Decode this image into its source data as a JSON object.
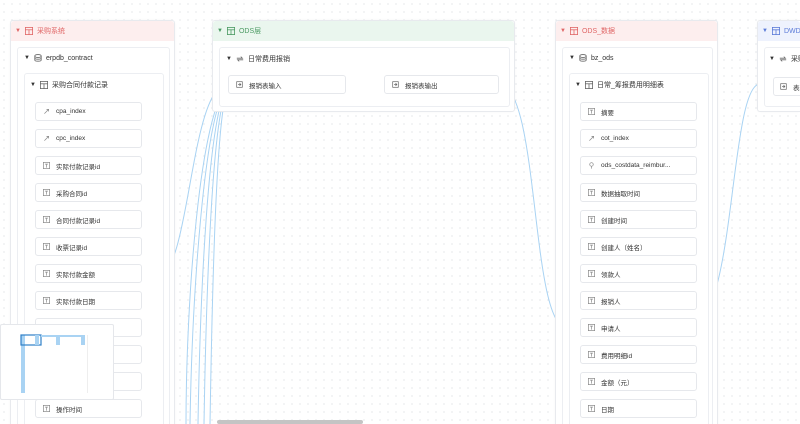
{
  "colors": {
    "source_accent": "#e06666",
    "ods_accent": "#4a9a62",
    "dwd_accent": "#5b7bd8",
    "edge": "#a9d3f3"
  },
  "panels": {
    "source": {
      "title": "采购系统",
      "db": {
        "name": "erpdb_contract",
        "icon": "database-icon"
      },
      "table": {
        "name": "采购合同付款记录",
        "icon": "table-icon",
        "fields": [
          {
            "name": "cpa_index",
            "icon": "link-icon"
          },
          {
            "name": "cpc_index",
            "icon": "link-icon"
          },
          {
            "name": "实际付款记录id",
            "icon": "text-type-icon"
          },
          {
            "name": "采购合同id",
            "icon": "text-type-icon"
          },
          {
            "name": "合同付款记录id",
            "icon": "text-type-icon"
          },
          {
            "name": "收票记录id",
            "icon": "text-type-icon"
          },
          {
            "name": "实际付款金额",
            "icon": "text-type-icon"
          },
          {
            "name": "实际付款日期",
            "icon": "text-type-icon"
          },
          {
            "name": "",
            "icon": "text-type-icon"
          },
          {
            "name": "",
            "icon": "text-type-icon"
          },
          {
            "name": "",
            "icon": "text-type-icon"
          },
          {
            "name": "操作时间",
            "icon": "text-type-icon"
          }
        ]
      }
    },
    "ods_layer": {
      "title": "ODS层",
      "process": {
        "name": "日常费用报销",
        "icon": "sync-icon"
      },
      "steps": [
        {
          "name": "报销表输入",
          "icon": "file-input-icon"
        },
        {
          "name": "报销表输出",
          "icon": "file-output-icon"
        }
      ]
    },
    "ods_data": {
      "title": "ODS_数据",
      "db": {
        "name": "bz_ods",
        "icon": "database-icon"
      },
      "table": {
        "name": "日常_筹报费用明细表",
        "icon": "table-icon",
        "fields": [
          {
            "name": "摘要",
            "icon": "text-type-icon"
          },
          {
            "name": "cot_index",
            "icon": "link-icon"
          },
          {
            "name": "ods_costdata_reimbur...",
            "icon": "pin-icon"
          },
          {
            "name": "数据抽取时间",
            "icon": "text-type-icon"
          },
          {
            "name": "创建时间",
            "icon": "text-type-icon"
          },
          {
            "name": "创建人（姓名）",
            "icon": "text-type-icon"
          },
          {
            "name": "领款人",
            "icon": "text-type-icon"
          },
          {
            "name": "报销人",
            "icon": "text-type-icon"
          },
          {
            "name": "申请人",
            "icon": "text-type-icon"
          },
          {
            "name": "费用明细id",
            "icon": "text-type-icon"
          },
          {
            "name": "金额（元）",
            "icon": "text-type-icon"
          },
          {
            "name": "日期",
            "icon": "text-type-icon"
          }
        ]
      }
    },
    "dwd": {
      "title": "DWD层",
      "process": {
        "name": "采购",
        "icon": "sync-icon"
      },
      "step": {
        "name": "表输",
        "icon": "file-input-icon"
      }
    }
  }
}
